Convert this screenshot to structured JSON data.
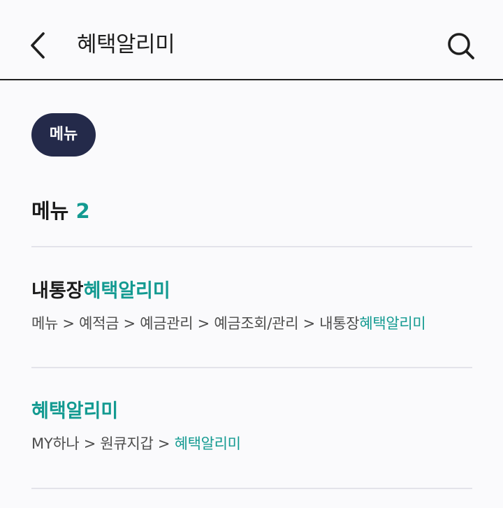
{
  "header": {
    "title": "혜택알리미",
    "back_icon": "chevron-left-icon",
    "search_icon": "search-icon"
  },
  "filter_chip": {
    "label": "메뉴"
  },
  "section": {
    "label": "메뉴",
    "count": "2"
  },
  "colors": {
    "accent": "#139a91",
    "chip_bg": "#242a4a"
  },
  "results": [
    {
      "title_prefix": "내통장",
      "title_highlight": "혜택알리미",
      "path_prefix": "메뉴 > 예적금 > 예금관리 > 예금조회/관리 > 내통장",
      "path_highlight": "혜택알리미"
    },
    {
      "title_prefix": "",
      "title_highlight": "혜택알리미",
      "path_prefix": "MY하나 > 원큐지갑 > ",
      "path_highlight": "혜택알리미"
    }
  ]
}
